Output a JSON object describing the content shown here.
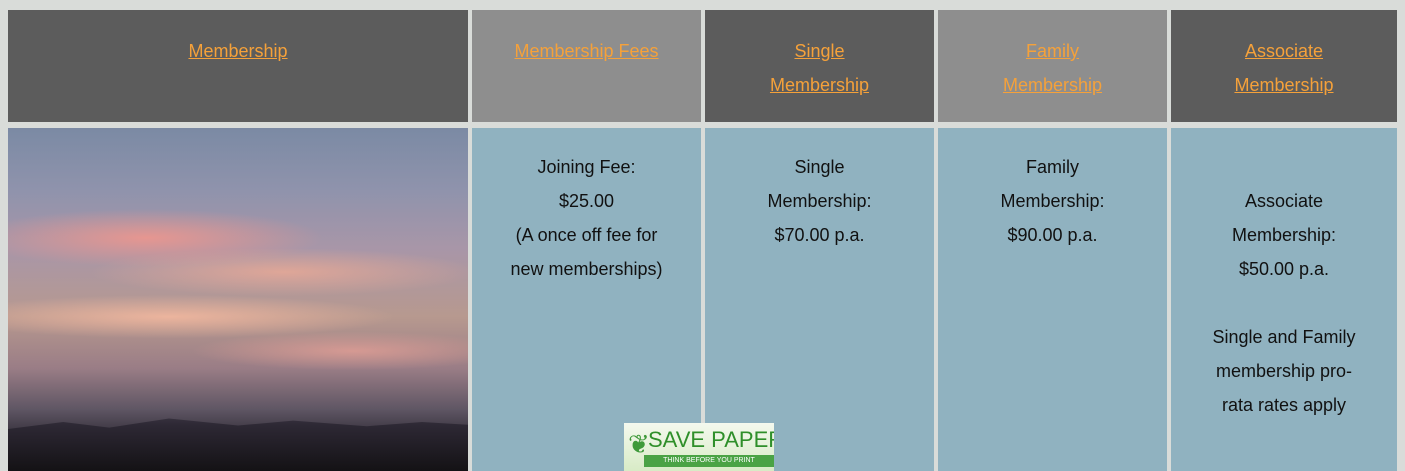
{
  "header": {
    "membership": "Membership",
    "fees": "Membership Fees",
    "single_line1": "Single",
    "single_line2": "Membership",
    "family_line1": "Family",
    "family_line2": "Membership",
    "associate_line1": "Associate",
    "associate_line2": "Membership"
  },
  "body": {
    "joining": [
      "Joining Fee:",
      "$25.00",
      "(A once off fee for",
      "new memberships)"
    ],
    "single": [
      "Single",
      "Membership:",
      "$70.00 p.a."
    ],
    "family": [
      "Family",
      "Membership:",
      "$90.00 p.a."
    ],
    "associate": [
      "Associate",
      "Membership:",
      "$50.00 p.a."
    ],
    "prorata": [
      "Single and Family",
      "membership pro-",
      "rata rates apply"
    ]
  },
  "badge": {
    "title": "SAVE PAPER",
    "subtitle": "THINK BEFORE YOU PRINT"
  },
  "colors": {
    "link": "#f5a13a",
    "dark_header": "#5c5c5c",
    "light_header": "#8e8e8e",
    "cell_blue": "#90b2c0"
  },
  "icons": {
    "image": "sunset-sky-photo",
    "badge": "save-paper-leaf-icon"
  }
}
